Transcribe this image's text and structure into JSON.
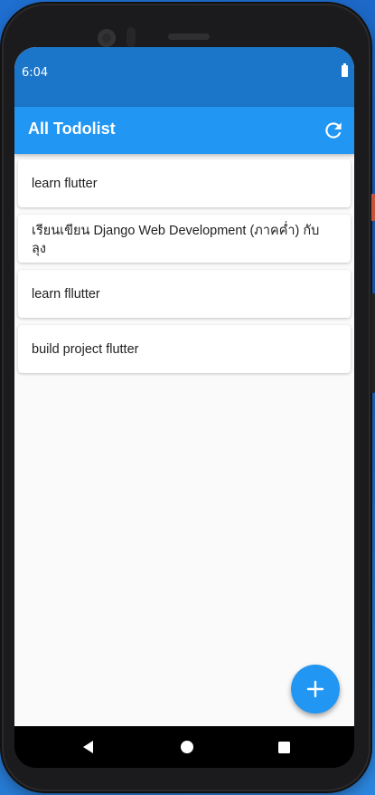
{
  "status_bar": {
    "time": "6:04"
  },
  "app_bar": {
    "title": "All Todolist",
    "refresh_icon": "refresh-icon"
  },
  "todos": [
    "learn flutter",
    "เรียนเขียน Django Web Development (ภาคค่ำ) กับ ลุง",
    "learn fllutter",
    "build project flutter"
  ],
  "fab": {
    "icon": "add-icon"
  },
  "nav": {
    "back_icon": "back-triangle-icon",
    "home_icon": "home-circle-icon",
    "recents_icon": "recents-square-icon"
  },
  "colors": {
    "primary": "#2196f3",
    "status_bar": "#1b75c9",
    "background": "#fafafa"
  }
}
